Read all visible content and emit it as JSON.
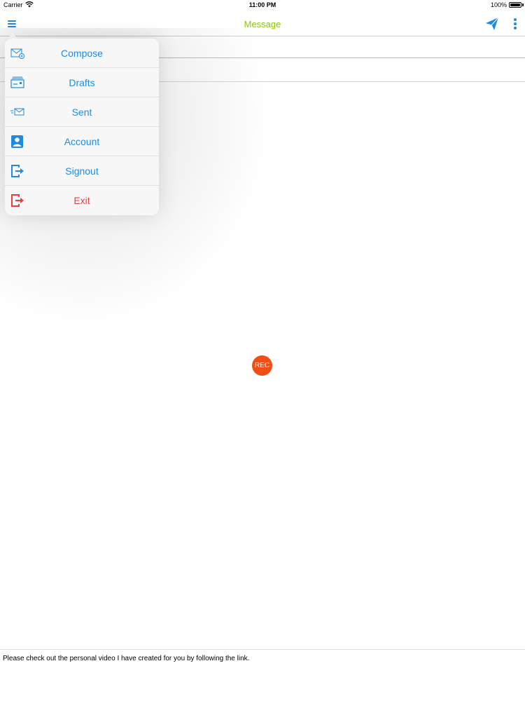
{
  "status_bar": {
    "carrier": "Carrier",
    "time": "11:00 PM",
    "battery": "100%"
  },
  "nav": {
    "title": "Message",
    "title_color": "#8bc40a",
    "accent_color": "#1f8ae0",
    "left_icon": "hamburger-menu-icon",
    "right_icons": [
      "send-paper-plane-icon",
      "more-vertical-icon"
    ]
  },
  "menu": {
    "items": [
      {
        "label": "Compose",
        "icon": "envelope-compose-icon"
      },
      {
        "label": "Drafts",
        "icon": "drafts-tray-icon"
      },
      {
        "label": "Sent",
        "icon": "sent-envelope-icon"
      },
      {
        "label": "Account",
        "icon": "account-contact-icon"
      },
      {
        "label": "Signout",
        "icon": "signout-door-icon"
      },
      {
        "label": "Exit",
        "icon": "exit-door-icon",
        "color": "#ee3b3b"
      }
    ]
  },
  "record": {
    "label": "REC",
    "color": "#f04e12"
  },
  "footer": {
    "message": "Please check out the personal video I have created for you by following the link."
  }
}
